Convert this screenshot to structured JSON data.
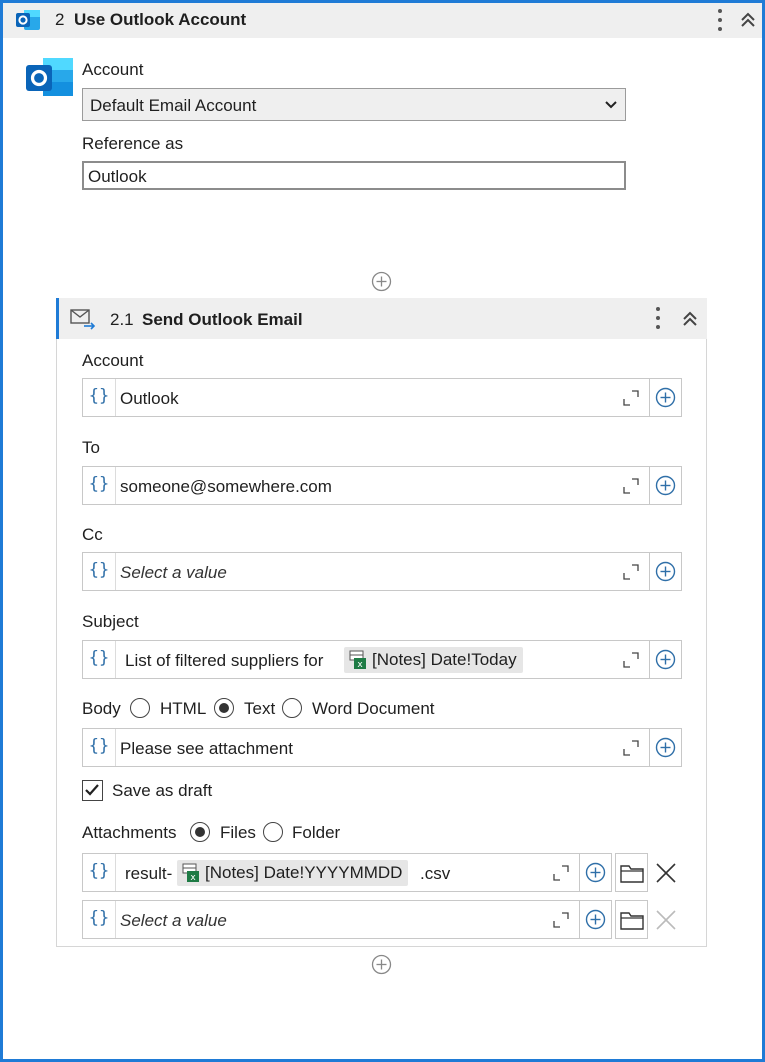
{
  "header": {
    "step_number": "2",
    "title": "Use Outlook Account"
  },
  "main": {
    "account_label": "Account",
    "account_value": "Default Email Account",
    "reference_label": "Reference as",
    "reference_value": "Outlook"
  },
  "send_email": {
    "step_number": "2.1",
    "title": "Send Outlook Email",
    "account_label": "Account",
    "account_value": "Outlook",
    "to_label": "To",
    "to_value": "someone@somewhere.com",
    "cc_label": "Cc",
    "cc_placeholder": "Select a value",
    "subject_label": "Subject",
    "subject_text": "List of filtered suppliers for",
    "subject_chip": "[Notes] Date!Today",
    "body_label": "Body",
    "body_options": [
      "HTML",
      "Text",
      "Word Document"
    ],
    "body_selected": "Text",
    "body_value": "Please see attachment",
    "save_draft_label": "Save as draft",
    "save_draft_checked": true,
    "attachments_label": "Attachments",
    "attachment_options": [
      "Files",
      "Folder"
    ],
    "attachment_selected": "Files",
    "attachment1_prefix": "result-",
    "attachment1_chip": "[Notes] Date!YYYYMMDD",
    "attachment1_suffix": ".csv",
    "attachment2_placeholder": "Select a value",
    "brace_symbol": "{}"
  },
  "icons": [
    "outlook-icon",
    "mail-send-icon",
    "kebab-menu-icon",
    "collapse-icon",
    "add-circle-icon",
    "expand-icon",
    "excel-icon",
    "folder-icon",
    "close-icon",
    "chevron-down-icon"
  ],
  "colors": {
    "accent": "#1f7bd6",
    "header_bg": "#efefef",
    "brace": "#2f6fa8",
    "excel_green": "#1e7b45"
  }
}
